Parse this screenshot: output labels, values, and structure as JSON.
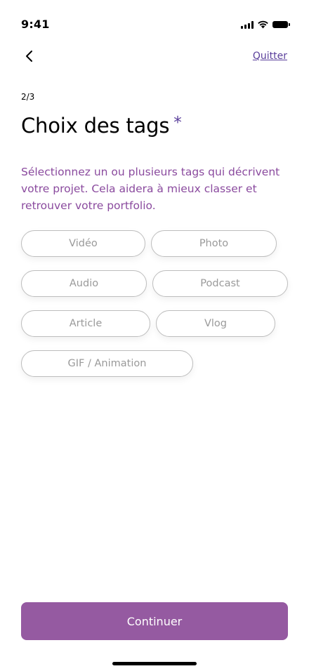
{
  "status_bar": {
    "time": "9:41",
    "icons": [
      "cellular-signal-icon",
      "wifi-icon",
      "battery-icon"
    ]
  },
  "header": {
    "back_icon": "chevron-left-icon",
    "quit_label": "Quitter"
  },
  "step": {
    "label": "2/3"
  },
  "title": {
    "text": "Choix des tags",
    "required_marker": "*"
  },
  "description": "Sélectionnez un ou plusieurs tags qui décrivent votre projet. Cela aidera à mieux classer et retrouver votre portfolio.",
  "tags": [
    {
      "label": "Vidéo"
    },
    {
      "label": "Photo"
    },
    {
      "label": "Audio"
    },
    {
      "label": "Podcast"
    },
    {
      "label": "Article"
    },
    {
      "label": "Vlog"
    },
    {
      "label": "GIF / Animation"
    }
  ],
  "continue_button": {
    "label": "Continuer"
  },
  "colors": {
    "accent": "#955aa1",
    "link": "#5a3f9b",
    "description": "#8a4a9e",
    "tag_border": "#bdbdbd",
    "tag_text": "#9a9a9a"
  }
}
